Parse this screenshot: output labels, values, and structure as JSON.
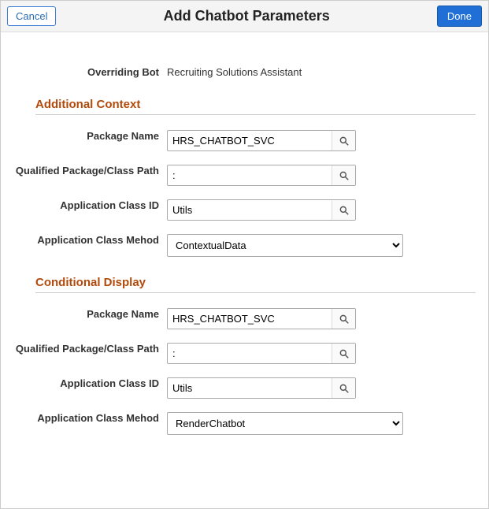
{
  "header": {
    "cancel_label": "Cancel",
    "title": "Add Chatbot Parameters",
    "done_label": "Done"
  },
  "overriding_bot": {
    "label": "Overriding Bot",
    "value": "Recruiting Solutions Assistant"
  },
  "sections": {
    "additional_context": {
      "title": "Additional Context",
      "package_name": {
        "label": "Package Name",
        "value": "HRS_CHATBOT_SVC"
      },
      "qualified_path": {
        "label": "Qualified Package/Class Path",
        "value": ":"
      },
      "app_class_id": {
        "label": "Application Class ID",
        "value": "Utils"
      },
      "app_class_method": {
        "label": "Application Class Mehod",
        "value": "ContextualData"
      }
    },
    "conditional_display": {
      "title": "Conditional Display",
      "package_name": {
        "label": "Package Name",
        "value": "HRS_CHATBOT_SVC"
      },
      "qualified_path": {
        "label": "Qualified Package/Class Path",
        "value": ":"
      },
      "app_class_id": {
        "label": "Application Class ID",
        "value": "Utils"
      },
      "app_class_method": {
        "label": "Application Class Mehod",
        "value": "RenderChatbot"
      }
    }
  }
}
